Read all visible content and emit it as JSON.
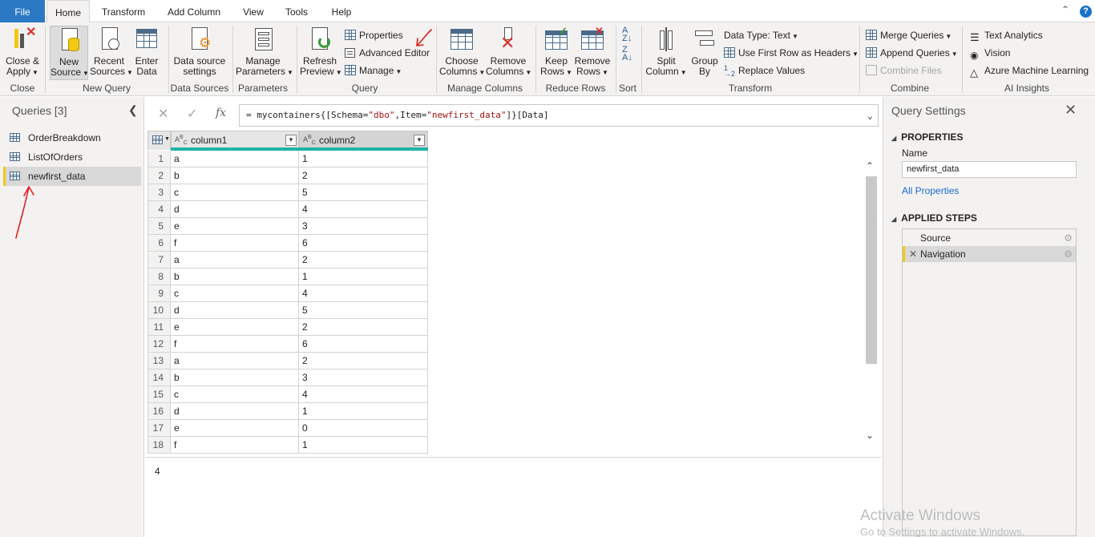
{
  "tabs": [
    "File",
    "Home",
    "Transform",
    "Add Column",
    "View",
    "Tools",
    "Help"
  ],
  "ribbon": {
    "close": {
      "label1": "Close &",
      "label2": "Apply",
      "group": "Close"
    },
    "new_query": {
      "new_source1": "New",
      "new_source2": "Source",
      "recent1": "Recent",
      "recent2": "Sources",
      "enter1": "Enter",
      "enter2": "Data",
      "group": "New Query"
    },
    "data_sources": {
      "label1": "Data source",
      "label2": "settings",
      "group": "Data Sources"
    },
    "parameters": {
      "label1": "Manage",
      "label2": "Parameters",
      "group": "Parameters"
    },
    "query": {
      "refresh1": "Refresh",
      "refresh2": "Preview",
      "properties": "Properties",
      "advanced_editor": "Advanced Editor",
      "manage": "Manage",
      "group": "Query"
    },
    "manage_columns": {
      "choose1": "Choose",
      "choose2": "Columns",
      "remove1": "Remove",
      "remove2": "Columns",
      "group": "Manage Columns"
    },
    "reduce_rows": {
      "keep1": "Keep",
      "keep2": "Rows",
      "remove1": "Remove",
      "remove2": "Rows",
      "group": "Reduce Rows"
    },
    "sort": {
      "group": "Sort"
    },
    "transform": {
      "split1": "Split",
      "split2": "Column",
      "group1": "Group",
      "group2": "By",
      "data_type": "Data Type: Text",
      "first_row": "Use First Row as Headers",
      "replace": "Replace Values",
      "group": "Transform"
    },
    "combine": {
      "merge": "Merge Queries",
      "append": "Append Queries",
      "combine_files": "Combine Files",
      "group": "Combine"
    },
    "ai": {
      "text_analytics": "Text Analytics",
      "vision": "Vision",
      "azure_ml": "Azure Machine Learning",
      "group": "AI Insights"
    }
  },
  "queries": {
    "title": "Queries [3]",
    "items": [
      "OrderBreakdown",
      "ListOfOrders",
      "newfirst_data"
    ],
    "active": "newfirst_data"
  },
  "formula": {
    "prefix": "= mycontainers{[Schema=",
    "schema": "\"dbo\"",
    "mid": ",Item=",
    "item": "\"newfirst_data\"",
    "suffix": "]}[Data]"
  },
  "grid": {
    "columns": [
      "column1",
      "column2"
    ],
    "rows": [
      [
        "a",
        "1"
      ],
      [
        "b",
        "2"
      ],
      [
        "c",
        "5"
      ],
      [
        "d",
        "4"
      ],
      [
        "e",
        "3"
      ],
      [
        "f",
        "6"
      ],
      [
        "a",
        "2"
      ],
      [
        "b",
        "1"
      ],
      [
        "c",
        "4"
      ],
      [
        "d",
        "5"
      ],
      [
        "e",
        "2"
      ],
      [
        "f",
        "6"
      ],
      [
        "a",
        "2"
      ],
      [
        "b",
        "3"
      ],
      [
        "c",
        "4"
      ],
      [
        "d",
        "1"
      ],
      [
        "e",
        "0"
      ],
      [
        "f",
        "1"
      ]
    ],
    "status_value": "4"
  },
  "settings": {
    "title": "Query Settings",
    "properties": "PROPERTIES",
    "name_label": "Name",
    "name_value": "newfirst_data",
    "all_properties": "All Properties",
    "applied_steps": "APPLIED STEPS",
    "steps": [
      "Source",
      "Navigation"
    ]
  },
  "watermark": {
    "line1": "Activate Windows",
    "line2": "Go to Settings to activate Windows."
  },
  "colors": {
    "file_tab": "#2b78c5",
    "accent_yellow": "#f2c811",
    "column_underline": "#1eb5a6",
    "annotation": "#e02020"
  }
}
